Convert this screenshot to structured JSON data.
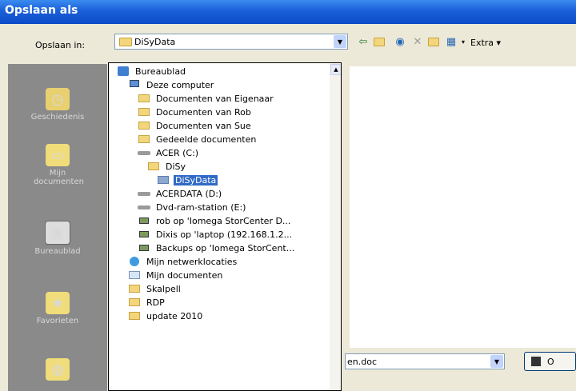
{
  "window": {
    "title": "Opslaan als"
  },
  "save_in": {
    "label": "Opslaan in:",
    "value": "DiSyData"
  },
  "toolbar": {
    "extra_label": "Extra"
  },
  "places": [
    {
      "label": "Geschiedenis",
      "icon": "history-icon"
    },
    {
      "label": "Mijn documenten",
      "icon": "my-documents-icon"
    },
    {
      "label": "Bureaublad",
      "icon": "desktop-icon"
    },
    {
      "label": "Favorieten",
      "icon": "favorites-icon"
    },
    {
      "label": "",
      "icon": "network-icon"
    }
  ],
  "dropdown_items": [
    {
      "label": "Bureaublad",
      "icon": "desktop-icon"
    },
    {
      "label": "Deze computer",
      "icon": "computer-icon"
    },
    {
      "label": "Documenten van Eigenaar",
      "icon": "folder-icon"
    },
    {
      "label": "Documenten van Rob",
      "icon": "folder-icon"
    },
    {
      "label": "Documenten van Sue",
      "icon": "folder-icon"
    },
    {
      "label": "Gedeelde documenten",
      "icon": "folder-icon"
    },
    {
      "label": "ACER (C:)",
      "icon": "drive-icon"
    },
    {
      "label": "DiSy",
      "icon": "folder-icon"
    },
    {
      "label": "DiSyData",
      "icon": "folder-icon",
      "selected": true
    },
    {
      "label": "ACERDATA (D:)",
      "icon": "drive-icon"
    },
    {
      "label": "Dvd-ram-station (E:)",
      "icon": "dvd-drive-icon"
    },
    {
      "label": "rob op 'Iomega StorCenter D...",
      "icon": "network-drive-icon"
    },
    {
      "label": "Dixis op 'laptop (192.168.1.2...",
      "icon": "network-drive-icon"
    },
    {
      "label": "Backups op 'Iomega StorCent...",
      "icon": "network-drive-icon"
    },
    {
      "label": "Mijn netwerklocaties",
      "icon": "network-places-icon"
    },
    {
      "label": "Mijn documenten",
      "icon": "my-documents-icon"
    },
    {
      "label": "Skalpell",
      "icon": "folder-icon"
    },
    {
      "label": "RDP",
      "icon": "folder-icon"
    },
    {
      "label": "update 2010",
      "icon": "folder-icon"
    }
  ],
  "filename": {
    "value": "en.doc"
  },
  "save_button": {
    "label": "O"
  }
}
